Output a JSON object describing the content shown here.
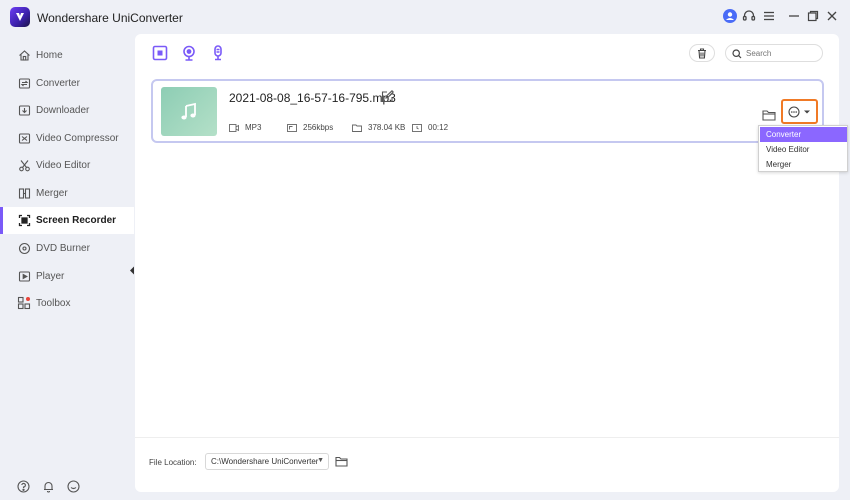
{
  "app": {
    "title": "Wondershare UniConverter"
  },
  "titlebar_icons": [
    "user-icon",
    "headset-icon",
    "menu-icon",
    "minimize-icon",
    "restore-icon",
    "close-icon"
  ],
  "sidebar": {
    "items": [
      {
        "label": "Home",
        "icon": "home-icon"
      },
      {
        "label": "Converter",
        "icon": "converter-icon"
      },
      {
        "label": "Downloader",
        "icon": "downloader-icon"
      },
      {
        "label": "Video Compressor",
        "icon": "compress-icon"
      },
      {
        "label": "Video Editor",
        "icon": "scissors-icon"
      },
      {
        "label": "Merger",
        "icon": "merge-icon"
      },
      {
        "label": "Screen Recorder",
        "icon": "record-icon",
        "active": true
      },
      {
        "label": "DVD Burner",
        "icon": "disc-icon"
      },
      {
        "label": "Player",
        "icon": "play-icon"
      },
      {
        "label": "Toolbox",
        "icon": "grid-icon"
      }
    ],
    "bottom_icons": [
      "help-icon",
      "bell-icon",
      "feedback-icon"
    ]
  },
  "toolbar": {
    "record_modes": [
      "screen-record-icon",
      "webcam-icon",
      "microphone-icon"
    ],
    "search_placeholder": "Search"
  },
  "file": {
    "name": "2021-08-08_16-57-16-795.mp3",
    "format": "MP3",
    "bitrate": "256kbps",
    "size": "378.04 KB",
    "duration": "00:12"
  },
  "dropdown": {
    "items": [
      {
        "label": "Converter",
        "selected": true
      },
      {
        "label": "Video Editor"
      },
      {
        "label": "Merger"
      }
    ]
  },
  "footer": {
    "file_location_label": "File Location:",
    "file_location_value": "C:\\Wondershare UniConverter"
  },
  "colors": {
    "accent": "#7a5af8",
    "highlight": "#f07a26",
    "dropdown_selected": "#8b67ff",
    "background": "#eef0f6"
  }
}
